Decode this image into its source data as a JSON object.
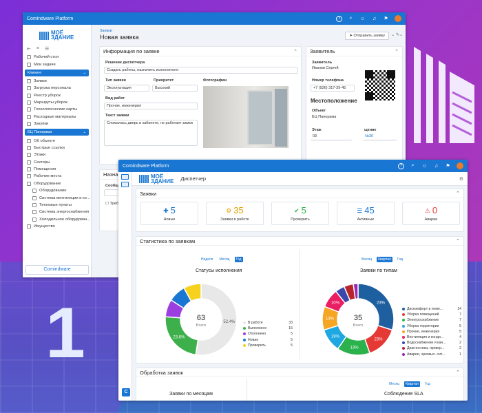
{
  "window_back": {
    "app_title": "Comindware Platform",
    "logo_line1": "МОЁ",
    "logo_line2": "ЗДАНИЕ",
    "logo_small": "Системная",
    "sidebar_sections": [
      {
        "type": "item",
        "label": "Рабочий стол"
      },
      {
        "type": "item",
        "label": "Мои задачи"
      },
      {
        "type": "section",
        "label": "Клининг"
      },
      {
        "type": "item",
        "label": "Заявки"
      },
      {
        "type": "item",
        "label": "Загрузка персонала"
      },
      {
        "type": "item",
        "label": "Реестр уборок"
      },
      {
        "type": "item",
        "label": "Маршруты уборок"
      },
      {
        "type": "item",
        "label": "Технологические карты"
      },
      {
        "type": "item",
        "label": "Расходные материалы"
      },
      {
        "type": "item",
        "label": "Закупки"
      },
      {
        "type": "section",
        "label": "БЦ Панорама"
      },
      {
        "type": "item",
        "label": "Об объекте"
      },
      {
        "type": "item",
        "label": "Быстрые ссылки"
      },
      {
        "type": "item",
        "label": "Этажи"
      },
      {
        "type": "item",
        "label": "Секторы"
      },
      {
        "type": "item",
        "label": "Помещения"
      },
      {
        "type": "item",
        "label": "Рабочие места"
      },
      {
        "type": "item",
        "label": "Оборудование"
      },
      {
        "type": "sub",
        "label": "Оборудование"
      },
      {
        "type": "sub",
        "label": "Система вентиляции и ко..."
      },
      {
        "type": "sub",
        "label": "Тепловые пункты"
      },
      {
        "type": "sub",
        "label": "Система энергоснабжения"
      },
      {
        "type": "sub",
        "label": "Холодильное оборудован..."
      },
      {
        "type": "item",
        "label": "Имущество"
      }
    ],
    "footer_brand": "Comindware",
    "breadcrumb": "Заявки",
    "page_title": "Новая заявка",
    "send_button": "Отправить заявку",
    "request_panel": {
      "title": "Информация по заявке",
      "decision_label": "Решение диспетчера",
      "decision_value": "Создать работы, назначить исполнителя",
      "type_label": "Тип заявки",
      "type_value": "Эксплуатация",
      "priority_label": "Приоритет",
      "priority_value": "Высокий",
      "photos_label": "Фотографии",
      "work_kind_label": "Вид работ",
      "work_kind_value": "Прочие, инженерия",
      "text_label": "Текст заявки",
      "text_value": "Сломалась дверь в кабинете, не работает замок"
    },
    "applicant_panel": {
      "title": "Заявитель",
      "applicant_label": "Заявитель",
      "applicant_value": "Иванов Сергей",
      "phone_label": "Номер телефона",
      "phone_value": "+7 (926) 317-39-45",
      "location_title": "Местоположение",
      "object_label": "Объект",
      "object_value": "БЦ Панорама",
      "floor_label": "Этаж",
      "floor_value": "03",
      "room_label": "щение",
      "room_value": "№36"
    },
    "assign_panel": {
      "title": "Назна",
      "msg_label": "Сообщ",
      "req_label": "Треб"
    }
  },
  "window_front": {
    "app_title": "Comindware Platform",
    "header_title": "Диспетчер",
    "requests_section": "Заявки",
    "stats": [
      {
        "icon": "✚",
        "value": "5",
        "label": "Новые",
        "color": "#1976d2"
      },
      {
        "icon": "⚙",
        "value": "35",
        "label": "Заявки в работе",
        "color": "#e0a100"
      },
      {
        "icon": "✔",
        "value": "5",
        "label": "Проверить",
        "color": "#2bb24c"
      },
      {
        "icon": "☰",
        "value": "45",
        "label": "Активные",
        "color": "#1976d2"
      },
      {
        "icon": "⚠",
        "value": "0",
        "label": "Аварии",
        "color": "#e53935"
      }
    ],
    "statistics_section": "Статистика по заявкам",
    "seg_left": [
      "Неделя",
      "Месяц",
      "Год"
    ],
    "seg_right": [
      "Месяц",
      "Квартал",
      "Год"
    ],
    "processing_section": "Обработка заявок",
    "seg_bottom": [
      "Месяц",
      "Квартал",
      "Год"
    ],
    "chart_bottom_left": "Заявки по месяцам",
    "chart_bottom_right": "Соблюдение SLA"
  },
  "chart_data": [
    {
      "type": "pie",
      "title": "Статусы исполнения",
      "center_value": "63",
      "center_label": "Всего",
      "categories": [
        "В работе",
        "Выполнено",
        "Отклонено",
        "Новая",
        "Проверить"
      ],
      "values": [
        33,
        15,
        5,
        5,
        5
      ],
      "slice_labels": [
        "52.4%",
        "23.8%",
        "",
        "",
        ""
      ],
      "colors": [
        "#e8e8e8",
        "#3db04c",
        "#9c3fe0",
        "#1976d2",
        "#f6d21f"
      ]
    },
    {
      "type": "pie",
      "title": "Заявки по типам",
      "center_value": "35",
      "center_label": "Всего",
      "categories": [
        "Дискомфорт в поме...",
        "Уборка помещений",
        "Электроснабжение",
        "Уборка территории",
        "Прочие, инженерия",
        "Вентиляция и конди...",
        "Водоснабжение и кан...",
        "Диагностика, провер...",
        "Аварии, чрезвыч. сит..."
      ],
      "values": [
        14,
        7,
        7,
        5,
        5,
        4,
        2,
        2,
        1
      ],
      "slice_labels": [
        "23%",
        "23%",
        "13%",
        "19%",
        "13%",
        "10%",
        "",
        "",
        ""
      ],
      "colors": [
        "#1e5fa0",
        "#e53935",
        "#2bb24c",
        "#1ea7e1",
        "#f5a623",
        "#e91e63",
        "#3949ab",
        "#b7252c",
        "#9c27b0"
      ]
    }
  ]
}
